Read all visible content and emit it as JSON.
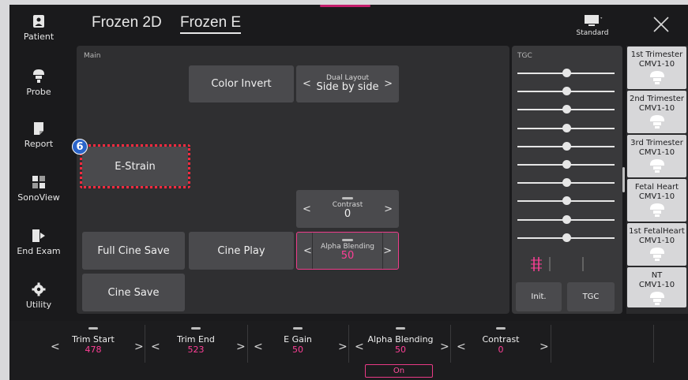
{
  "header": {
    "tabs": [
      {
        "label": "Frozen 2D",
        "active": false
      },
      {
        "label": "Frozen E",
        "active": true
      }
    ],
    "display_mode": "Standard"
  },
  "sidebar": {
    "items": [
      {
        "label": "Patient",
        "icon": "patient-icon"
      },
      {
        "label": "Probe",
        "icon": "probe-icon"
      },
      {
        "label": "Report",
        "icon": "report-icon"
      },
      {
        "label": "SonoView",
        "icon": "sonoview-icon"
      },
      {
        "label": "End Exam",
        "icon": "end-exam-icon"
      },
      {
        "label": "Utility",
        "icon": "gear-icon"
      }
    ]
  },
  "main": {
    "panel_label": "Main",
    "color_invert": "Color Invert",
    "dual_layout": {
      "label": "Dual Layout",
      "value": "Side by side"
    },
    "callout_number": "6",
    "e_strain": "E-Strain",
    "contrast": {
      "label": "Contrast",
      "value": "0"
    },
    "full_cine_save": "Full Cine Save",
    "cine_play": "Cine Play",
    "alpha_blending": {
      "label": "Alpha Blending",
      "value": "50"
    },
    "cine_save": "Cine Save"
  },
  "tgc": {
    "panel_label": "TGC",
    "init_label": "Init.",
    "tgc_label": "TGC",
    "slider_levels": [
      0.5,
      0.5,
      0.5,
      0.5,
      0.5,
      0.5,
      0.5,
      0.5,
      0.5,
      0.5
    ]
  },
  "presets": [
    {
      "name": "1st Trimester",
      "sub": "CMV1-10"
    },
    {
      "name": "2nd Trimester",
      "sub": "CMV1-10"
    },
    {
      "name": "3rd Trimester",
      "sub": "CMV1-10"
    },
    {
      "name": "Fetal Heart",
      "sub": "CMV1-10"
    },
    {
      "name": "1st FetalHeart",
      "sub": "CMV1-10"
    },
    {
      "name": "NT",
      "sub": "CMV1-10"
    }
  ],
  "bottom": {
    "controls": [
      {
        "label": "Trim Start",
        "value": "478"
      },
      {
        "label": "Trim End",
        "value": "523"
      },
      {
        "label": "E Gain",
        "value": "50"
      },
      {
        "label": "Alpha Blending",
        "value": "50"
      },
      {
        "label": "Contrast",
        "value": "0"
      }
    ],
    "on_label": "On"
  },
  "colors": {
    "accent_pink": "#ff3f97",
    "callout_red": "#ff2a3f",
    "callout_badge": "#2a63c9"
  }
}
